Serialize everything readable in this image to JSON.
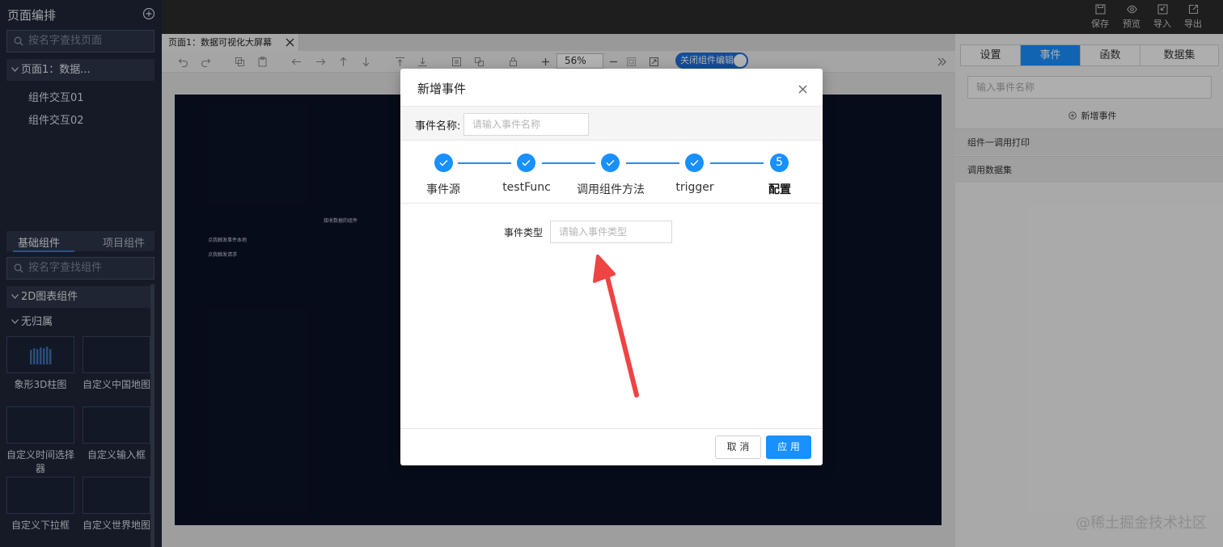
{
  "left_panel": {
    "title": "页面编排",
    "page_search_placeholder": "按名字查找页面",
    "page_tree_root": "页面1：数据...",
    "page_tree_children": [
      "组件交互01",
      "组件交互02"
    ],
    "component_tabs": [
      "基础组件",
      "项目组件"
    ],
    "component_search_placeholder": "按名字查找组件",
    "group_2d": "2D图表组件",
    "group_none": "无归属",
    "tiles": [
      "象形3D柱图",
      "自定义中国地图",
      "自定义时间选择器",
      "自定义输入框",
      "自定义下拉框",
      "自定义世界地图"
    ]
  },
  "top_bar": {
    "save": "保存",
    "preview": "预览",
    "import": "导入",
    "export": "导出"
  },
  "editor": {
    "page_tab": "页面1：数据可视化大屏幕",
    "zoom": "56%",
    "toggle_label": "关闭组件编辑",
    "canvas_texts": [
      "接收数据的组件",
      "点我触发事件本地",
      "点我触发请求"
    ]
  },
  "right_panel": {
    "tabs": [
      "设置",
      "事件",
      "函数",
      "数据集"
    ],
    "active_tab": "事件",
    "event_name_placeholder": "输入事件名称",
    "add_event": "新增事件",
    "events": [
      "组件一调用打印",
      "调用数据集"
    ]
  },
  "modal": {
    "title": "新增事件",
    "name_label": "事件名称:",
    "name_placeholder": "请输入事件名称",
    "steps": [
      "事件源",
      "testFunc",
      "调用组件方法",
      "trigger",
      "配置"
    ],
    "current_step_number": "5",
    "type_label": "事件类型",
    "type_placeholder": "请输入事件类型",
    "cancel": "取 消",
    "apply": "应 用"
  },
  "watermark": "@稀土掘金技术社区",
  "colors": {
    "primary": "#1890ff",
    "sidebar": "#1f2637",
    "canvas": "#0b1226",
    "arrow": "#ef4444"
  }
}
